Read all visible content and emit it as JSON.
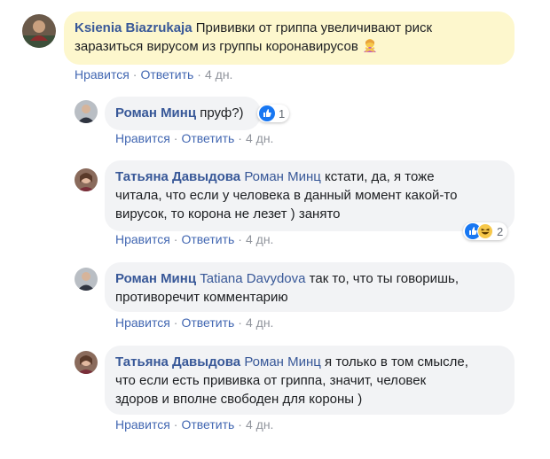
{
  "comments": [
    {
      "author": "Ksienia Biazrukaja",
      "text_line1": "Прививки от гриппа увеличивают риск",
      "text_line2": "заразиться вирусом из группы коронавирусов",
      "emoji": "person-gesturing-no-emoji",
      "like": "Нравится",
      "reply": "Ответить",
      "time": "4 дн."
    },
    {
      "author": "Роман Минц",
      "text": "пруф?)",
      "reaction_count": "1",
      "like": "Нравится",
      "reply": "Ответить",
      "time": "4 дн."
    },
    {
      "author": "Татьяна Давыдова",
      "mention": "Роман Минц",
      "text_line1": "кстати, да, я тоже",
      "text_line2": "читала, что если у человека в данный момент какой-то",
      "text_line3": "вирусок, то корона не лезет ) занято",
      "reaction_count": "2",
      "like": "Нравится",
      "reply": "Ответить",
      "time": "4 дн."
    },
    {
      "author": "Роман Минц",
      "mention": "Tatiana Davydova",
      "text_line1": "так то, что ты говоришь,",
      "text_line2": "противоречит комментарию",
      "like": "Нравится",
      "reply": "Ответить",
      "time": "4 дн."
    },
    {
      "author": "Татьяна Давыдова",
      "mention": "Роман Минц",
      "text_line1": "я только в том смысле,",
      "text_line2": "что если есть прививка от гриппа, значит, человек",
      "text_line3": "здоров и вполне свободен для короны )",
      "like": "Нравится",
      "reply": "Ответить",
      "time": "4 дн."
    }
  ],
  "colors": {
    "link": "#385898",
    "bubble_highlight": "#fdf7cd",
    "bubble": "#f2f3f5",
    "like_reaction": "#1877f2"
  }
}
